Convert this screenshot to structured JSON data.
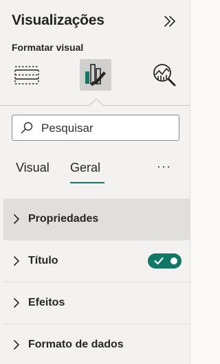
{
  "pane": {
    "title": "Visualizações",
    "subtitle": "Formatar visual",
    "collapse_icon": "double-chevron-right-icon"
  },
  "visual_tabs": [
    {
      "name": "build-visual",
      "icon": "table-grid-icon",
      "active": false
    },
    {
      "name": "format-visual",
      "icon": "paintbrush-chart-icon",
      "active": true
    },
    {
      "name": "analytics",
      "icon": "magnifier-chart-icon",
      "active": false
    }
  ],
  "search": {
    "placeholder": "Pesquisar",
    "value": ""
  },
  "format_tabs": {
    "visual": "Visual",
    "geral": "Geral",
    "selected": "Geral",
    "more": "···"
  },
  "sections": [
    {
      "label": "Propriedades",
      "hovered": true
    },
    {
      "label": "Título",
      "toggle": true,
      "toggle_on": true
    },
    {
      "label": "Efeitos"
    },
    {
      "label": "Formato de dados"
    }
  ],
  "colors": {
    "accent": "#117865",
    "pane_background": "#f3f2f1",
    "hover_background": "#e1dfdd"
  }
}
